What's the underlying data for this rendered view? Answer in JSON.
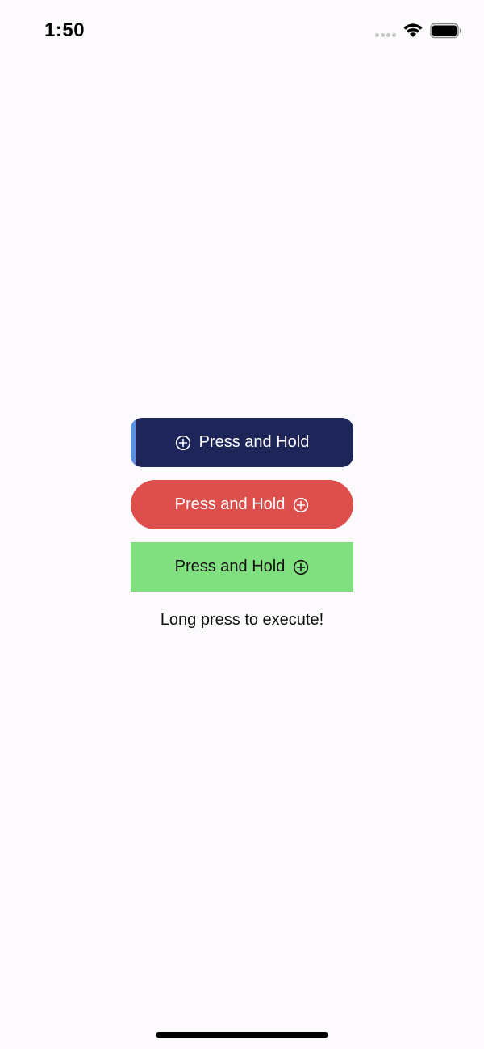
{
  "status_bar": {
    "time": "1:50",
    "wifi_icon": "wifi-icon",
    "battery_icon": "battery-icon",
    "signal_icon": "cellular-signal-icon"
  },
  "buttons": [
    {
      "label": "Press and Hold",
      "icon": "plus-circle-icon",
      "icon_position": "left",
      "background": "#1e2559",
      "text_color": "#ffffff",
      "hold_progress": 0.02,
      "progress_color": "#5b8fe0"
    },
    {
      "label": "Press and Hold",
      "icon": "plus-circle-icon",
      "icon_position": "right",
      "background": "#dc4f4c",
      "text_color": "#ffffff"
    },
    {
      "label": "Press and Hold",
      "icon": "plus-circle-icon",
      "icon_position": "right",
      "background": "#80e07f",
      "text_color": "#111111"
    }
  ],
  "caption": "Long press to execute!"
}
